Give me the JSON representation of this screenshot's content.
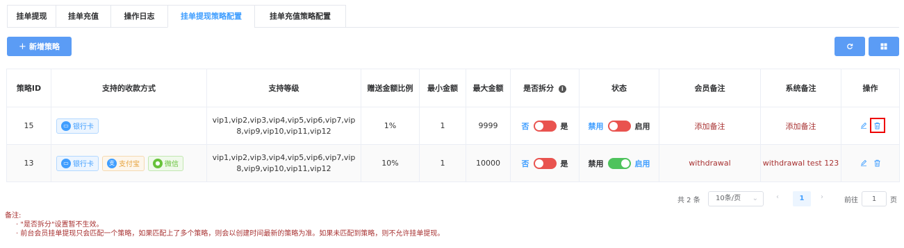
{
  "tabs": [
    {
      "label": "挂单提现"
    },
    {
      "label": "挂单充值"
    },
    {
      "label": "操作日志"
    },
    {
      "label": "挂单提现策略配置"
    },
    {
      "label": "挂单充值策略配置"
    }
  ],
  "active_tab": 3,
  "toolbar": {
    "add_label": "新增策略",
    "add_icon": "plus-icon",
    "refresh_icon": "refresh-icon",
    "columns_icon": "grid-icon"
  },
  "table": {
    "headers": [
      "策略ID",
      "支持的收款方式",
      "支持等级",
      "赠送金额比例",
      "最小金额",
      "最大金额",
      "是否拆分",
      "状态",
      "会员备注",
      "系统备注",
      "操作"
    ],
    "split_no": "否",
    "split_yes": "是",
    "status_off": "禁用",
    "status_on": "启用",
    "rows": [
      {
        "id": "15",
        "pay_methods": [
          {
            "label": "银行卡",
            "kind": "bank"
          }
        ],
        "levels": "vip1,vip2,vip3,vip4,vip5,vip6,vip7,vip8,vip9,vip10,vip11,vip12",
        "ratio": "1%",
        "min": "1",
        "max": "9999",
        "split": false,
        "status": false,
        "member_remark": "添加备注",
        "system_remark": "添加备注"
      },
      {
        "id": "13",
        "pay_methods": [
          {
            "label": "银行卡",
            "kind": "bank"
          },
          {
            "label": "支付宝",
            "kind": "ali"
          },
          {
            "label": "微信",
            "kind": "wx"
          }
        ],
        "levels": "vip1,vip2,vip3,vip4,vip5,vip6,vip7,vip8,vip9,vip10,vip11,vip12",
        "ratio": "10%",
        "min": "1",
        "max": "10000",
        "split": false,
        "status": true,
        "member_remark": "withdrawal",
        "system_remark": "withdrawal test 123"
      }
    ]
  },
  "pagination": {
    "total": "共 2 条",
    "page_size": "10条/页",
    "current_page": "1",
    "goto_label": "前往",
    "goto_value": "1",
    "page_suffix": "页"
  },
  "notes": {
    "title": "备注:",
    "items": [
      "· \"是否拆分\"设置暂不生效。",
      "· 前台会员挂单提现只会匹配一个策略，如果匹配上了多个策略，则会以创建时间最新的策略为准。如果未匹配到策略，则不允许挂单提现。"
    ]
  },
  "colors": {
    "primary": "#5b9cf5",
    "switch_off": "#e9534f",
    "switch_on": "#4fc35d",
    "remark": "#a83232"
  }
}
